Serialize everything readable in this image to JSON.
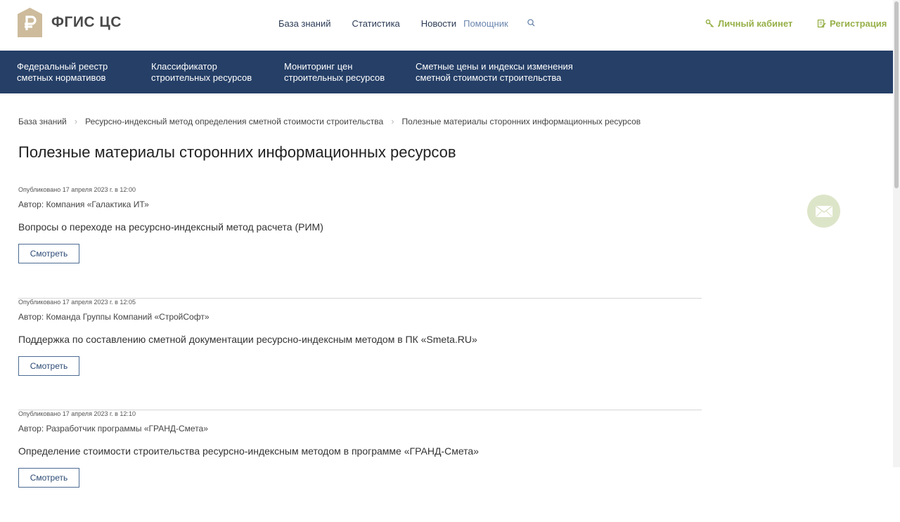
{
  "header": {
    "logo_text": "ФГИС ЦС",
    "nav": [
      {
        "label": "База знаний"
      },
      {
        "label": "Статистика"
      },
      {
        "label": "Новости"
      },
      {
        "label": "Помощник"
      }
    ],
    "account_label": "Личный кабинет",
    "register_label": "Регистрация"
  },
  "mainnav": [
    {
      "line1": "Федеральный реестр",
      "line2": "сметных нормативов"
    },
    {
      "line1": "Классификатор",
      "line2": "строительных ресурсов"
    },
    {
      "line1": "Мониторинг цен",
      "line2": "строительных ресурсов"
    },
    {
      "line1": "Сметные цены и индексы изменения",
      "line2": "сметной стоимости строительства"
    }
  ],
  "breadcrumb": [
    {
      "label": "База знаний"
    },
    {
      "label": "Ресурсно-индексный метод определения сметной стоимости строительства"
    },
    {
      "label": "Полезные материалы сторонних информационных ресурсов"
    }
  ],
  "page_title": "Полезные материалы сторонних информационных ресурсов",
  "articles": [
    {
      "published": "Опубликовано 17 апреля 2023 г. в 12:00",
      "author": "Автор: Компания «Галактика ИТ»",
      "title": "Вопросы о переходе на ресурсно-индексный метод расчета (РИМ)",
      "button": "Смотреть"
    },
    {
      "published": "Опубликовано 17 апреля 2023 г. в 12:05",
      "author": "Автор: Команда Группы Компаний «СтройСофт»",
      "title": "Поддержка по составлению сметной документации ресурсно-индексным методом в ПК «Smeta.RU»",
      "button": "Смотреть"
    },
    {
      "published": "Опубликовано 17 апреля 2023 г. в 12:10",
      "author": "Автор: Разработчик программы «ГРАНД-Смета»",
      "title": "Определение стоимости строительства ресурсно-индексным методом в программе «ГРАНД-Смета»",
      "button": "Смотреть"
    }
  ],
  "colors": {
    "nav_bg": "#253f67",
    "accent_green": "#96b048",
    "logo_beige": "#cdbb9c"
  },
  "icons": [
    "ruble-logo-icon",
    "search-icon",
    "key-icon",
    "edit-icon",
    "mail-icon"
  ]
}
